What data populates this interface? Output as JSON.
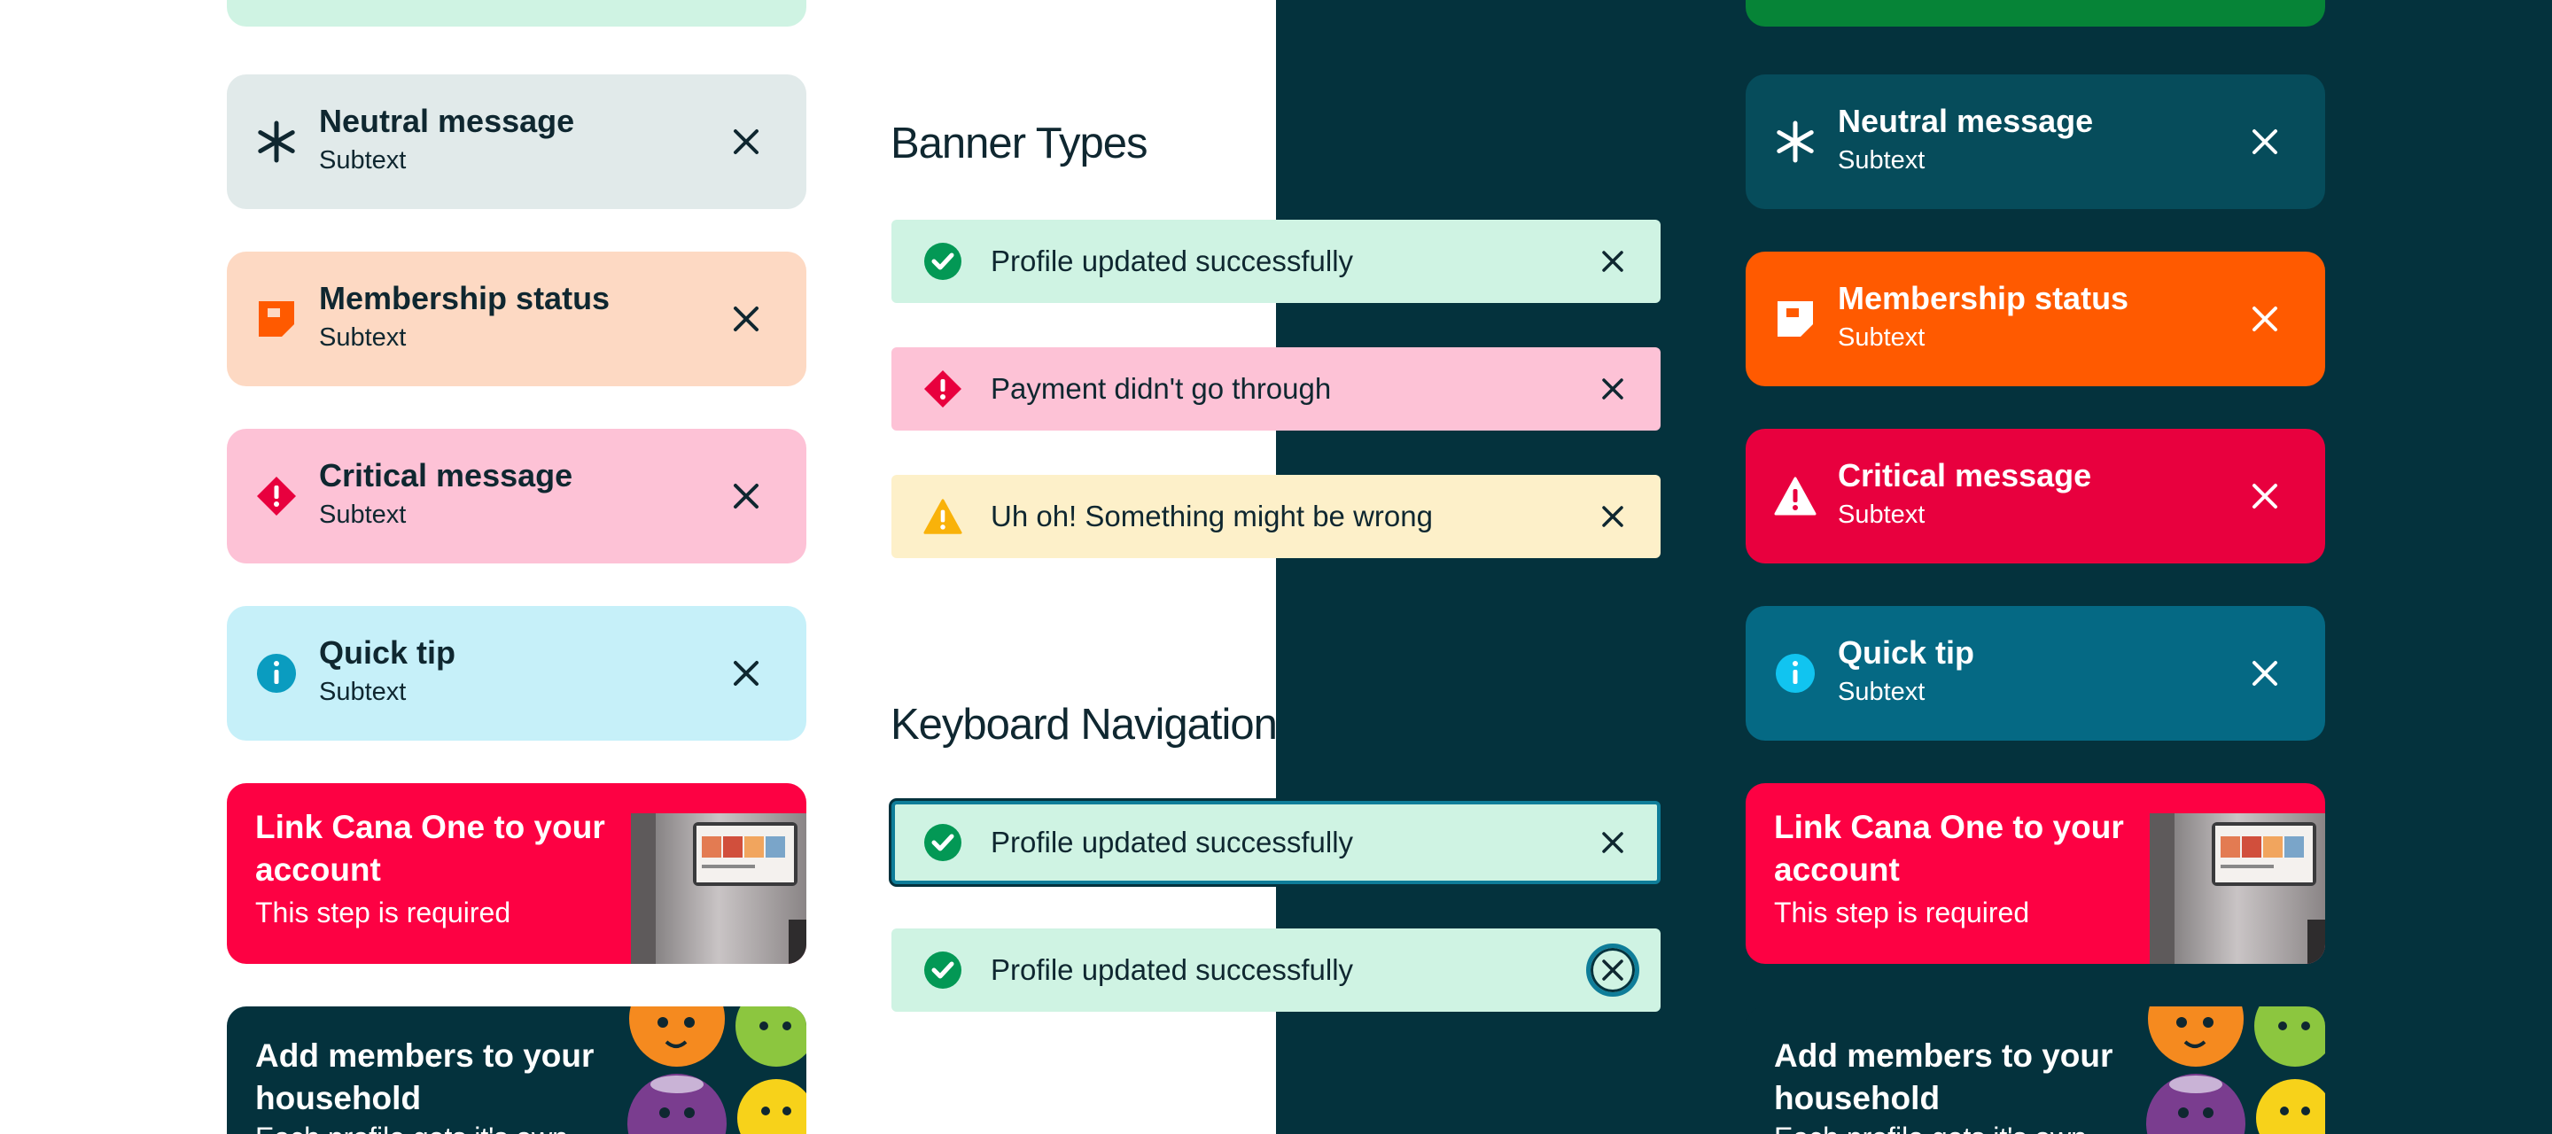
{
  "headings": {
    "banner_types": "Banner Types",
    "keyboard_navigation": "Keyboard Navigation"
  },
  "cards": {
    "neutral": {
      "title": "Neutral message",
      "subtext": "Subtext",
      "icon": "snowflake-icon"
    },
    "membership": {
      "title": "Membership status",
      "subtext": "Subtext",
      "icon": "bookmark-card-icon"
    },
    "critical": {
      "title": "Critical message",
      "subtext": "Subtext",
      "icon": "alert-icon"
    },
    "tip": {
      "title": "Quick tip",
      "subtext": "Subtext",
      "icon": "info-icon"
    }
  },
  "promos": {
    "link": {
      "title": "Link Cana One to your account",
      "subtext": "This step is required",
      "image": "cana-one-device-photo"
    },
    "household": {
      "title": "Add members to your household",
      "subtext": "Each profile gets it's own",
      "image": "fruit-characters-illustration"
    }
  },
  "banners": {
    "success": {
      "text": "Profile updated successfully",
      "icon": "check-circle-icon"
    },
    "error": {
      "text": "Payment didn't go through",
      "icon": "alert-diamond-icon"
    },
    "warning": {
      "text": "Uh oh! Something might be wrong",
      "icon": "warning-triangle-icon"
    }
  },
  "keyboard": {
    "focused_banner": {
      "text": "Profile updated successfully",
      "state": "banner focused"
    },
    "focused_close": {
      "text": "Profile updated successfully",
      "state": "close button focused"
    }
  },
  "colors": {
    "dark_background": "#04323d",
    "ink": "#0f2730",
    "light_neutral": "#e1eaea",
    "light_membership": "#fdd9c3",
    "light_critical": "#fdc2d6",
    "light_tip": "#c6f0f9",
    "light_success": "#cff3e3",
    "light_warning": "#fdf0c9",
    "dark_neutral": "#064c5b",
    "dark_membership": "#ff5a00",
    "dark_critical": "#e8003e",
    "dark_tip": "#056984",
    "dark_success": "#068437",
    "promo_red": "#fd0143",
    "promo_teal": "#04323d",
    "success_green": "#039855",
    "focus_ring": "#0f7d99"
  }
}
